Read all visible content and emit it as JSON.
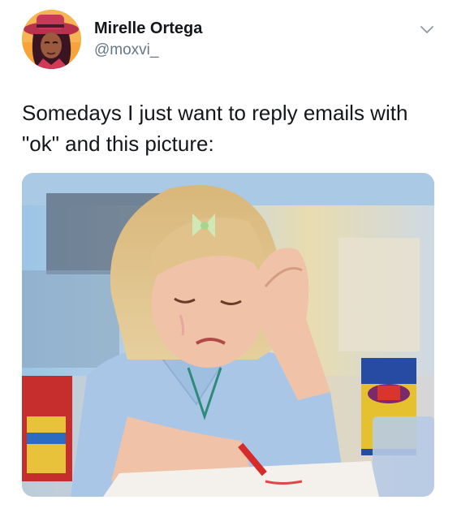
{
  "tweet": {
    "author": {
      "display_name": "Mirelle Ortega",
      "handle": "@moxvi_"
    },
    "text": "Somedays I just want to reply emails with \"ok\" and this picture:"
  },
  "icons": {
    "menu": "chevron-down-icon"
  },
  "colors": {
    "text_primary": "#14171a",
    "text_secondary": "#657786",
    "chevron": "#8899a6"
  }
}
